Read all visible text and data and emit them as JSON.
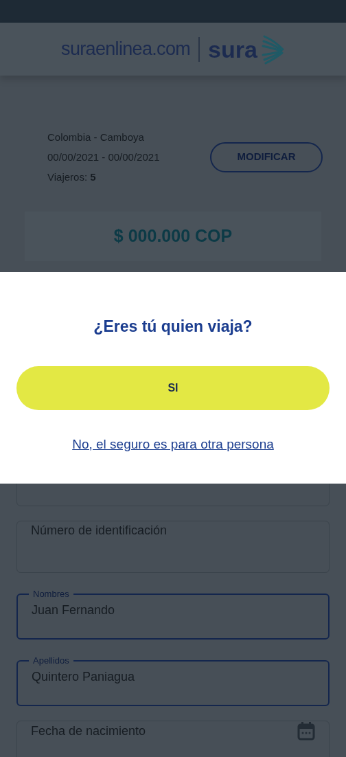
{
  "header": {
    "site": "suraenlinea.com",
    "brand": "sura"
  },
  "trip": {
    "route": "Colombia - Camboya",
    "dates": "00/00/2021 - 00/00/2021",
    "travelers": "Viajeros: **5**"
  },
  "modify_button": "MODIFICAR",
  "price": "$ 000.000 COP",
  "form": {
    "fields": [
      {
        "kind": "text"
      },
      {
        "kind": "text",
        "placeholder": "Número de identificación"
      },
      {
        "kind": "text",
        "label": "Nombres",
        "value": "Juan Fernando"
      },
      {
        "kind": "text",
        "label": "Apellidos",
        "value": "Quintero Paniagua"
      },
      {
        "kind": "date",
        "placeholder": "Fecha de nacimiento"
      }
    ]
  },
  "dialog": {
    "title": "¿Eres tú quien viaja?",
    "confirm_button": "SI",
    "link": "No, el seguro es para otra persona"
  }
}
